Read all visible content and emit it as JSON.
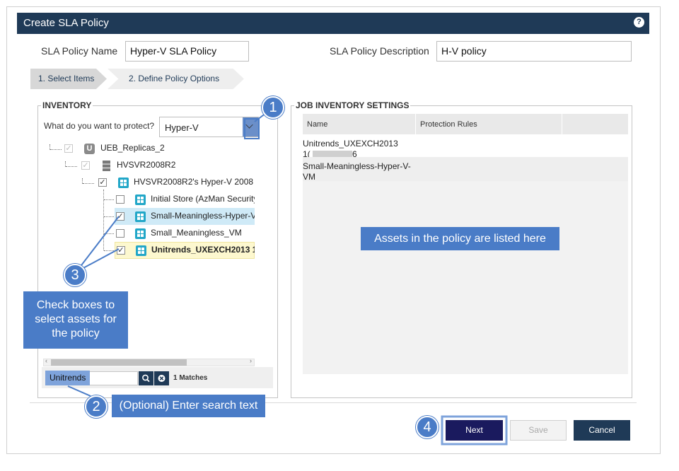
{
  "dialog": {
    "title": "Create SLA Policy",
    "help_icon": "help-icon"
  },
  "fields": {
    "name_label": "SLA Policy Name",
    "name_value": "Hyper-V SLA Policy",
    "desc_label": "SLA Policy Description",
    "desc_value": "H-V policy"
  },
  "steps": [
    "1. Select Items",
    "2. Define Policy Options"
  ],
  "inventory": {
    "legend": "INVENTORY",
    "question": "What do you want to protect?",
    "selected": "Hyper-V",
    "tree": [
      {
        "label": "UEB_Replicas_2",
        "icon": "unitrends-icon",
        "checked": true,
        "disabled": true
      },
      {
        "label": "HVSVR2008R2",
        "icon": "server-icon",
        "checked": true,
        "disabled": true
      },
      {
        "label": "HVSVR2008R2's Hyper-V 2008",
        "icon": "windows-icon",
        "checked": true,
        "disabled": false
      },
      {
        "label": "Initial Store (AzMan Security",
        "icon": "windows-icon",
        "checked": false
      },
      {
        "label": "Small-Meaningless-Hyper-V",
        "icon": "windows-icon",
        "checked": true
      },
      {
        "label": "Small_Meaningless_VM",
        "icon": "windows-icon",
        "checked": false
      },
      {
        "label": "Unitrends_UXEXCH2013 1",
        "icon": "windows-icon",
        "checked": true
      }
    ],
    "search_value": "Unitrends",
    "matches": "1 Matches",
    "search_icon": "search-icon",
    "clear_icon": "clear-icon"
  },
  "job_inventory": {
    "legend": "JOB INVENTORY SETTINGS",
    "columns": [
      "Name",
      "Protection Rules",
      ""
    ],
    "rows": [
      {
        "name_line1": "Unitrends_UXEXCH2013",
        "name_line2_start": "1(",
        "name_line2_end": "6",
        "rules": ""
      },
      {
        "name_line1": "Small-Meaningless-Hyper-V-",
        "name_line2": "VM",
        "rules": ""
      }
    ]
  },
  "callouts": {
    "one": "1",
    "two": "2",
    "three": "3",
    "four": "4",
    "check_boxes_text": "Check boxes to select assets for the policy",
    "search_text": "(Optional) Enter search text",
    "assets_text": "Assets in the policy are listed here"
  },
  "buttons": {
    "next": "Next",
    "save": "Save",
    "cancel": "Cancel"
  },
  "colors": {
    "title_bar": "#1f3a57",
    "callout": "#4a7cc7",
    "next_button": "#1a1a5e",
    "cancel_button": "#1f3a57"
  }
}
